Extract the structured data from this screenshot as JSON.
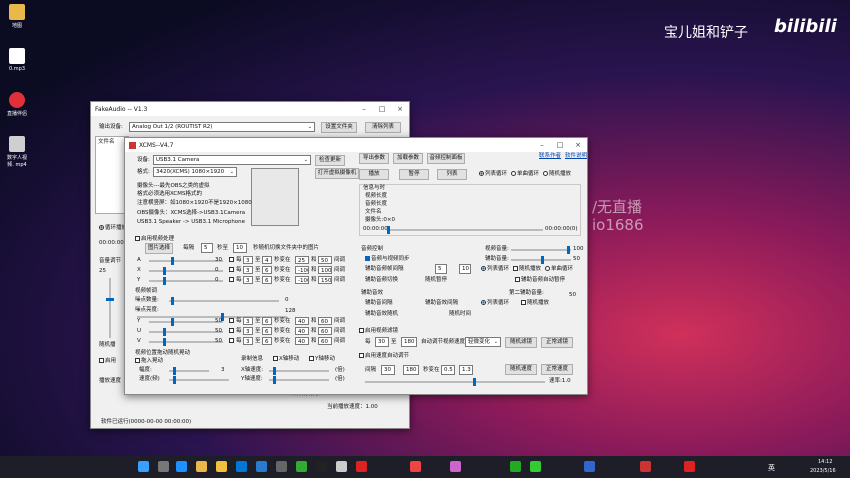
{
  "desktop": {
    "icons": [
      "地图",
      "0.mp3",
      "直播伴侣",
      "数字人视频.\nmp4"
    ]
  },
  "watermark": {
    "channel": "宝儿姐和铲子",
    "brand": "bilibili",
    "overlay1": "/无直播",
    "overlay2": "io1686"
  },
  "fakeaudio": {
    "title": "FakeAudio -- V1.3",
    "output_label": "输出设备:",
    "output_value": "Analog Out 1/2 (ROUTIST R2)",
    "set_folder": "设置文件夹",
    "clear_list": "清除列表",
    "file_label": "文件名",
    "loop_play": "循环播放",
    "time": "00:00:00",
    "volume": "音量调节",
    "vol_val": "25",
    "random_label": "随机播",
    "enable": "启用",
    "speed_label": "播放速度",
    "lower": "计算成功为",
    "duration": "软件已运行(0000-00-00 00:00:00)",
    "current_speed": "当前播放速度：1.00"
  },
  "xcms": {
    "title": "XCMS--V4.7",
    "links": [
      "联系作者",
      "软件说明"
    ],
    "device_label": "设备:",
    "device": "USB3.1 Camera",
    "check_update": "检查更新",
    "format_label": "格式:",
    "format": "3420(XCMS) 1080×1920",
    "open_cam": "打开虚拟摄像机",
    "info": [
      "摄像头---最先OBS之类的虚拟",
      "格式必须选用XCMS格式的",
      "注意横竖屏：如1080×1920不是1920×1080",
      "OBS摄像头：XCMS选择->USB3.1Camera",
      "USB3.1 Speaker -> USB3.1 Microphone"
    ],
    "btn_row1": [
      "导出参数",
      "加载参数",
      "音频控制面板"
    ],
    "btn_row2": [
      "播放",
      "暂停",
      "列表"
    ],
    "modes": [
      "列表循环",
      "单曲循环",
      "随机播放"
    ],
    "infobox": {
      "title": "信息与时",
      "lines": [
        "视频长度",
        "音频长度",
        "文件名",
        "摄像头:0×0"
      ],
      "t0": "00:00:00",
      "t1": "00:00:00(0)"
    },
    "enable_video": "启用视频处理",
    "pick": "图片选择",
    "interval": "每隔",
    "n5": "5",
    "sec": "秒至",
    "n10": "10",
    "rand_switch": "秒随机切换文件夹中的图片",
    "axes": [
      "A",
      "X",
      "Y"
    ],
    "axis_vals": [
      "30",
      "0",
      "0"
    ],
    "row": {
      "every": "每",
      "to": "至",
      "sec_at": "秒变在",
      "and": "和",
      "range": "间调"
    },
    "axis_rows": [
      [
        "3",
        "4",
        "25",
        "50"
      ],
      [
        "3",
        "6",
        "-100",
        "100"
      ],
      [
        "3",
        "6",
        "-100",
        "150"
      ]
    ],
    "video_sec": "视频帧调",
    "noise": "噪点数量:",
    "noise_v": "0",
    "noise2": "噪点亮度:",
    "noise2_v": "128",
    "yuv": [
      "Y",
      "U",
      "V"
    ],
    "yuv_vals": [
      "50",
      "50",
      "50"
    ],
    "yuv_rows": [
      [
        "3",
        "6",
        "40",
        "60"
      ],
      [
        "3",
        "6",
        "40",
        "60"
      ],
      [
        "3",
        "6",
        "40",
        "60"
      ]
    ],
    "shake_title": "视频位置拖动随机晃动",
    "shake_enable": "拖入晃动",
    "shake_amp": "幅度:",
    "shake_v": "3",
    "speed": "速度(频)",
    "record": "录制信息",
    "x_shift": "X轴移动",
    "y_shift": "Y轴移动",
    "x_speed": "X轴速度:",
    "y_speed": "Y轴速度:",
    "unit": "(倍)",
    "audio_ctrl": "音频控制",
    "sync": "音频与视频同步",
    "video_vol": "视频音量:",
    "vol100": "100",
    "aux_vol": "辅助音量:",
    "vol50": "50",
    "aux_sec": "辅助音频帧间隔",
    "loop_list": "列表循环",
    "rand_play": "随机播放",
    "single": "单曲循环",
    "aux_switch": "辅助音频切换",
    "aux_pause": "随机暂停",
    "auto_pause": "辅助音频自动暂停",
    "aux2": "辅助音效",
    "aux2_vol": "第二辅助音量:",
    "vol50b": "50",
    "aux2_sec": "辅助音间隔",
    "aux2_each": "辅助音效间隔",
    "aux2_rand": "辅助音效随机",
    "rand_time": "随机时间",
    "auto_sp": "启用视频滤镜",
    "each": "每",
    "n30": "30",
    "to": "至",
    "n180": "180",
    "auto_chg": "自动调节视频速度",
    "light_chg": "轻微变化",
    "rand_filter": "随机滤镜",
    "normal_filter": "正常滤镜",
    "auto_speed": "启用速度自动调节",
    "gap": "间隔",
    "n30b": "30",
    "n180b": "180",
    "sec_between": "秒变在",
    "r1": "0.5",
    "r2": "1.3",
    "rand_speed": "随机速度",
    "normal_speed": "正常速度",
    "speed_val": "速率:1.0"
  },
  "taskbar": {
    "time": "14:12",
    "date": "2023/5/16",
    "lang": "英"
  }
}
